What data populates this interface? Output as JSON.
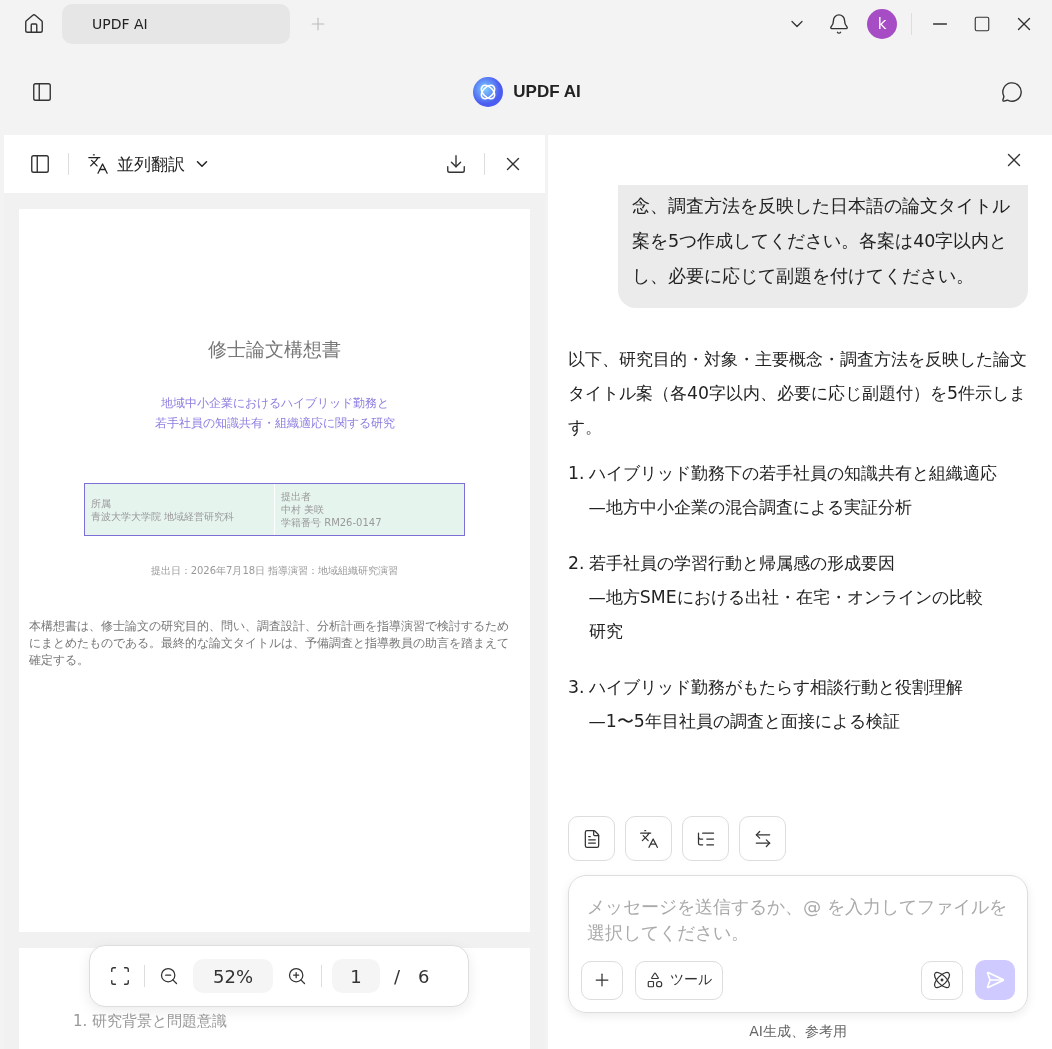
{
  "titlebar": {
    "tab": "UPDF AI",
    "avatar": "k"
  },
  "header": {
    "title": "UPDF AI"
  },
  "doc_panel": {
    "mode": "並列翻訳",
    "page": {
      "title": "修士論文構想書",
      "subtitle_lines": [
        "地域中小企業におけるハイブリッド勤務と",
        "若手社員の知識共有・組織適応に関する研究"
      ],
      "info_left": [
        "所属",
        "青波大学大学院 地域経営研究科"
      ],
      "info_right": [
        "提出者",
        "中村 美咲",
        "学籍番号 RM26-0147"
      ],
      "submission": "提出日：2026年7月18日 指導演習：地域組織研究演習",
      "note": "本構想書は、修士論文の研究目的、問い、調査設計、分析計画を指導演習で検討するためにまとめたものである。最終的な論文タイトルは、予備調査と指導教員の助言を踏まえて確定する。"
    },
    "next_page": {
      "heading": "1. 研究背景と問題意識"
    },
    "zoom": "52%",
    "page_number": "1",
    "page_separator": "/",
    "page_total": "6"
  },
  "chat": {
    "user_message": "念、調査方法を反映した日本語の論文タイトル案を5つ作成してください。各案は40字以内とし、必要に応じて副題を付けてください。",
    "reply": {
      "intro": "以下、研究目的・対象・主要概念・調査方法を反映した論文タイトル案（各40字以内、必要に応じ副題付）を5件示します。",
      "items": [
        {
          "number": "1.",
          "title": "ハイブリッド勤務下の若手社員の知識共有と組織適応",
          "subtitle": "—地方中小企業の混合調査による実証分析"
        },
        {
          "number": "2.",
          "title": "若手社員の学習行動と帰属感の形成要因",
          "subtitle": "—地方SMEにおける出社・在宅・オンラインの比較研究"
        },
        {
          "number": "3.",
          "title": "ハイブリッド勤務がもたらす相談行動と役割理解",
          "subtitle": "—1〜5年目社員の調査と面接による検証"
        }
      ]
    },
    "input": {
      "placeholder": "メッセージを送信するか、@ を入力してファイルを選択してください。"
    },
    "tools_label": "ツール",
    "disclaimer": "AI生成、参考用"
  }
}
